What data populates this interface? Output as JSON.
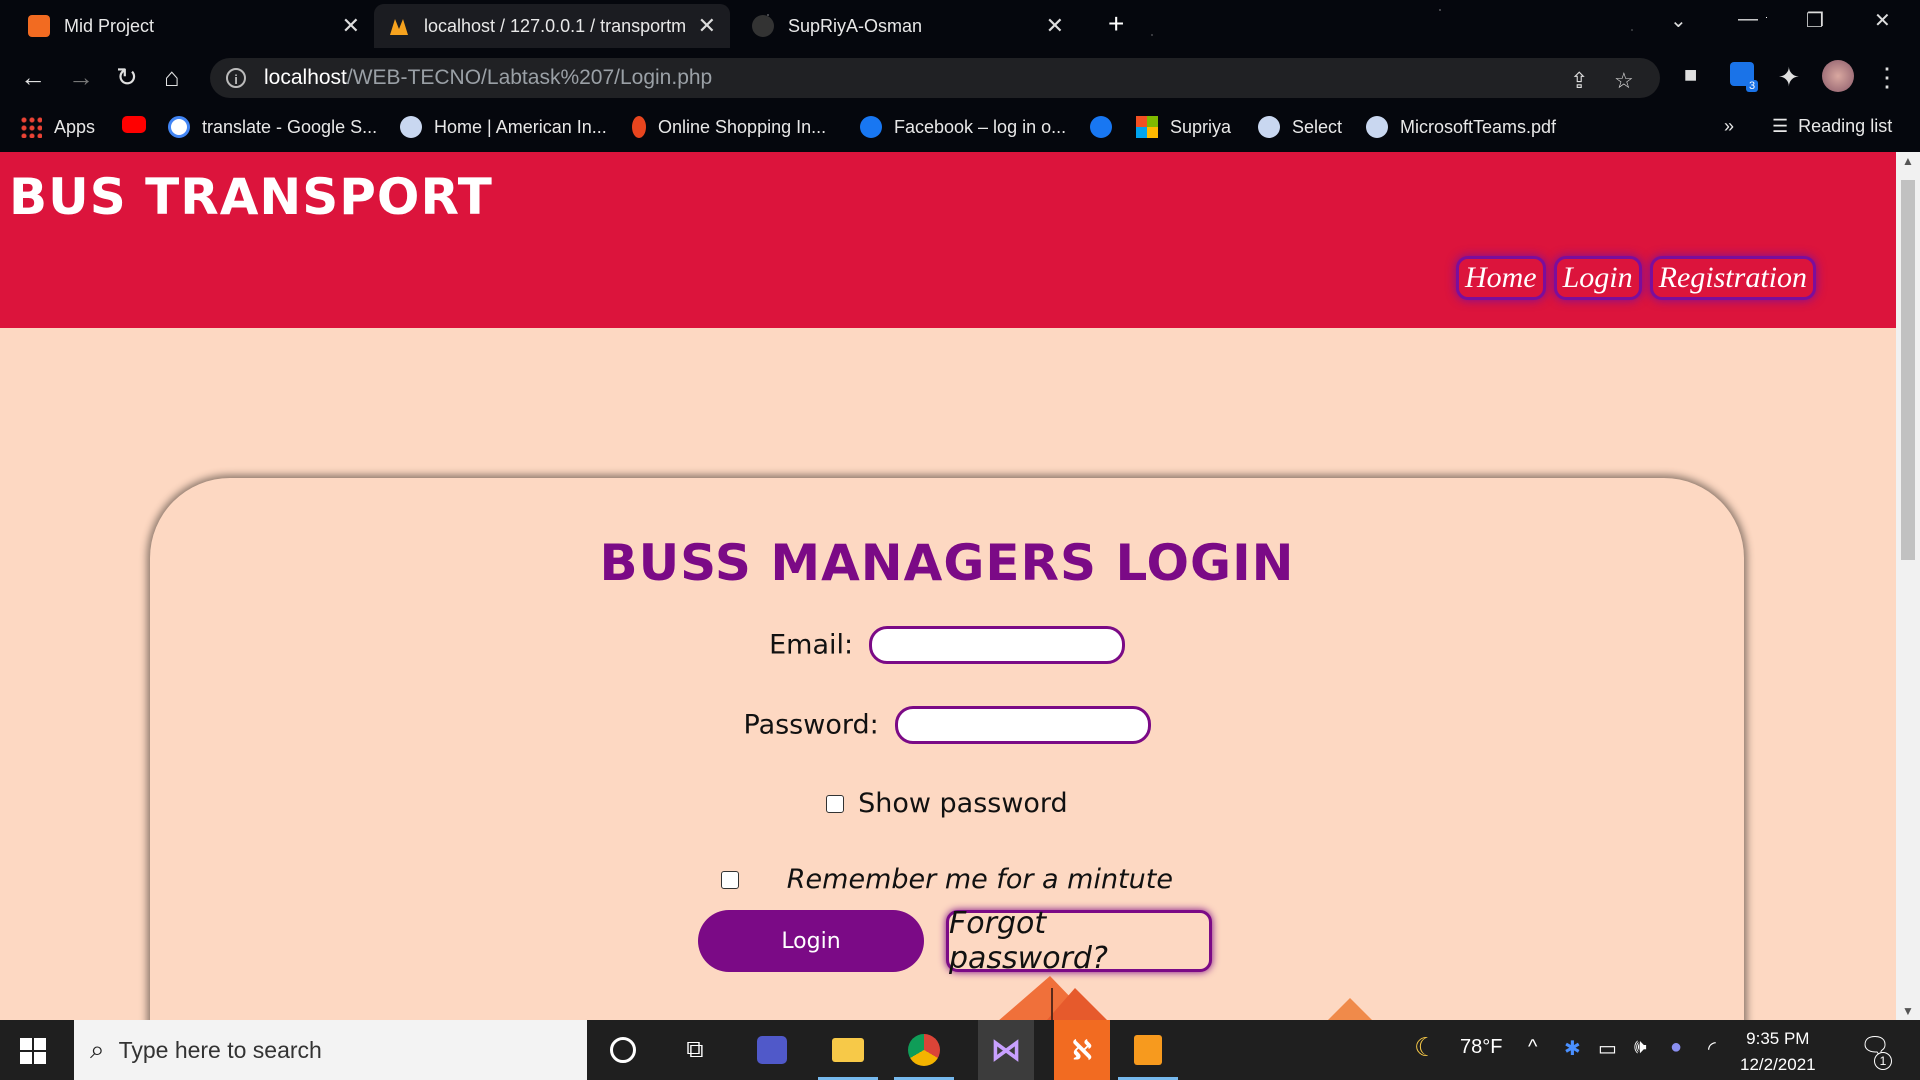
{
  "browser": {
    "tabs": [
      {
        "title": "Mid Project",
        "active": false
      },
      {
        "title": "localhost / 127.0.0.1 / transportm",
        "active": true
      },
      {
        "title": "SupRiyA-Osman",
        "active": false
      }
    ],
    "url_host": "localhost",
    "url_path": "/WEB-TECNO/Labtask%207/Login.php",
    "bookmarks": [
      {
        "label": "Apps"
      },
      {
        "label": ""
      },
      {
        "label": "translate - Google S..."
      },
      {
        "label": "Home | American In..."
      },
      {
        "label": "Online Shopping In..."
      },
      {
        "label": "Facebook – log in o..."
      },
      {
        "label": ""
      },
      {
        "label": "Supriya"
      },
      {
        "label": "Select"
      },
      {
        "label": "MicrosoftTeams.pdf"
      }
    ],
    "more_bookmarks": "»",
    "reading_list": "Reading list",
    "extension_badge": "3"
  },
  "site": {
    "brand": "BUS TRANSPORT",
    "nav": [
      "Home",
      "Login",
      "Registration"
    ],
    "colors": {
      "header": "#dc143c",
      "accent": "#7b0a86",
      "page_bg": "#fdd8c2"
    }
  },
  "login": {
    "title": "BUSS MANAGERS LOGIN",
    "email_label": "Email:",
    "password_label": "Password:",
    "show_password": "Show password",
    "remember_me": "Remember me for a mintute",
    "login_button": "Login",
    "forgot_button": "Forgot password?"
  },
  "taskbar": {
    "search_placeholder": "Type here to search",
    "weather": "78°F",
    "time": "9:35 PM",
    "date": "12/2/2021",
    "notification_count": "1"
  }
}
